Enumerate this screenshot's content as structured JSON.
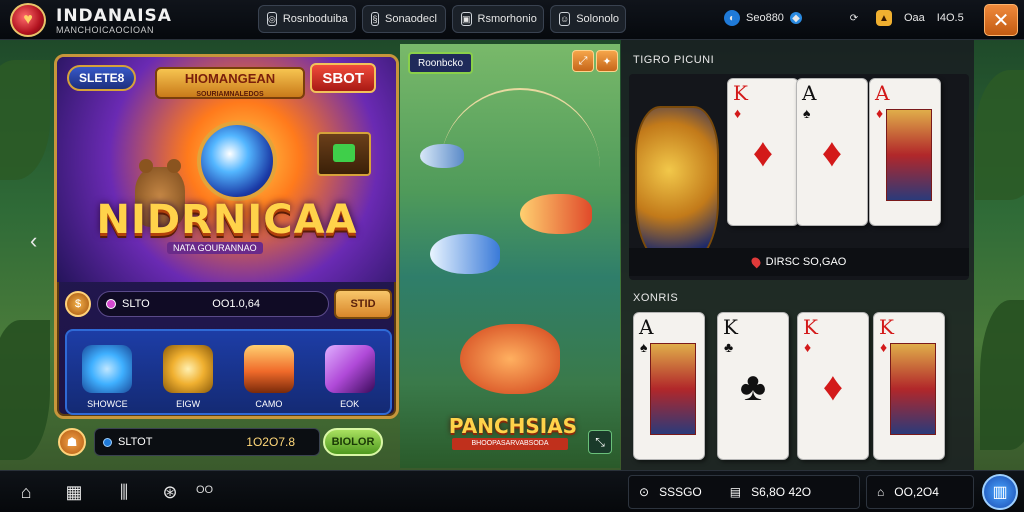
{
  "header": {
    "brand": "INDANAISA",
    "brand_sub": "MANCHOICAOCIOAN",
    "tabs": [
      {
        "label": "Rosnboduiba",
        "icon": "game-icon"
      },
      {
        "label": "Sonaodecl",
        "icon": "ticket-icon"
      },
      {
        "label": "Rsmorhonio",
        "icon": "gift-icon"
      },
      {
        "label": "Solonolo",
        "icon": "chat-icon"
      }
    ],
    "balance": "Seo880",
    "level": "I4O.5",
    "points_label": "Oaa"
  },
  "left_game": {
    "tag": "SLETE8",
    "top_banner": "HIOMANGEAN",
    "top_banner_sub": "SOURIAMNALEDOS",
    "badge": "SBOT",
    "title": "NIDRNICAA",
    "subtitle": "NATA GOURANNAO",
    "bet_label": "SLTO",
    "bet_value": "OO1.0,64",
    "bet_button": "STID",
    "features": [
      {
        "label": "SHOWCE",
        "color": "#3fb0ff"
      },
      {
        "label": "EIGW",
        "color": "#f0b030"
      },
      {
        "label": "CAMO",
        "color": "#f06a2a"
      },
      {
        "label": "EOK",
        "color": "#b04ad8"
      }
    ]
  },
  "spin_bar": {
    "label": "SLTOT",
    "value": "1O2O7.8",
    "button": "BIOLOR"
  },
  "fishing": {
    "tag": "Roonbcko",
    "title": "PANCHSIAS",
    "subtitle": "BHOOPASARVABSODA"
  },
  "cards": {
    "dealer_label": "TIGRO PICUNI",
    "dealer_amount": "DIRSC SO,GAO",
    "player_label": "XONRIS",
    "dealer_hand": [
      {
        "rank": "K",
        "suit": "♦",
        "color": "red",
        "face": false
      },
      {
        "rank": "A",
        "suit": "♠",
        "color": "blk",
        "face": false
      },
      {
        "rank": "A",
        "suit": "♦",
        "color": "red",
        "face": true
      }
    ],
    "player_hand": [
      {
        "rank": "A",
        "suit": "♠",
        "color": "blk",
        "face": true
      },
      {
        "rank": "K",
        "suit": "♣",
        "color": "blk",
        "face": false
      },
      {
        "rank": "K",
        "suit": "♦",
        "color": "red",
        "face": false
      },
      {
        "rank": "K",
        "suit": "♦",
        "color": "red",
        "face": true
      }
    ]
  },
  "footer": {
    "count_label": "OO",
    "stat_left": "SSSGO",
    "stat_mid": "S6,8O 42O",
    "stat_right": "OO,2O4"
  },
  "colors": {
    "accent_gold": "#d6a23a",
    "accent_orange": "#e07a2a",
    "panel_dark": "#14161b"
  }
}
